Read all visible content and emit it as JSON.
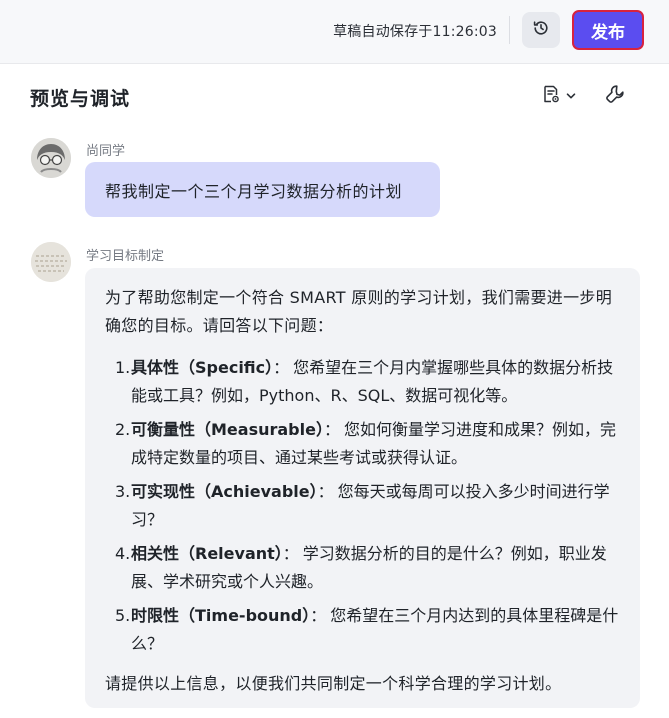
{
  "topbar": {
    "save_status": "草稿自动保存于11:26:03",
    "history_icon": "history-clock-icon",
    "publish_label": "发布"
  },
  "panel": {
    "title": "预览与调试",
    "tool_icons": [
      "doc-settings-icon",
      "chevron-down-icon",
      "wrench-icon"
    ]
  },
  "messages": {
    "user": {
      "name": "尚同学",
      "text": "帮我制定一个三个月学习数据分析的计划"
    },
    "bot": {
      "name": "学习目标制定",
      "intro": "为了帮助您制定一个符合 SMART 原则的学习计划，我们需要进一步明确您的目标。请回答以下问题：",
      "items": [
        {
          "num": "1.",
          "term": "具体性（Specific）",
          "sep": "：",
          "text": "您希望在三个月内掌握哪些具体的数据分析技能或工具？例如，Python、R、SQL、数据可视化等。"
        },
        {
          "num": "2.",
          "term": "可衡量性（Measurable）",
          "sep": "：",
          "text": "您如何衡量学习进度和成果？例如，完成特定数量的项目、通过某些考试或获得认证。"
        },
        {
          "num": "3.",
          "term": "可实现性（Achievable）",
          "sep": "：",
          "text": "您每天或每周可以投入多少时间进行学习？"
        },
        {
          "num": "4.",
          "term": "相关性（Relevant）",
          "sep": "：",
          "text": "学习数据分析的目的是什么？例如，职业发展、学术研究或个人兴趣。"
        },
        {
          "num": "5.",
          "term": "时限性（Time-bound）",
          "sep": "：",
          "text": "您希望在三个月内达到的具体里程碑是什么？"
        }
      ],
      "outro": "请提供以上信息，以便我们共同制定一个科学合理的学习计划。"
    }
  },
  "colors": {
    "publish_bg": "#5b4df0",
    "publish_border": "#d8233f",
    "user_bubble": "#d6d9fb",
    "bot_bubble": "#f2f3f6"
  }
}
